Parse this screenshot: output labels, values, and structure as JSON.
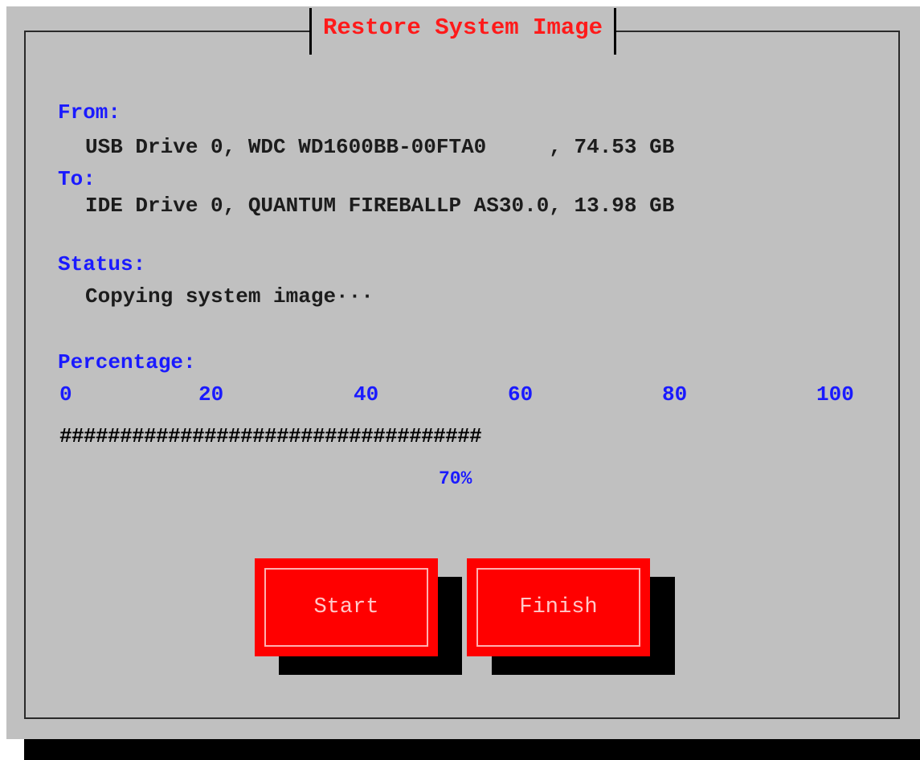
{
  "dialog": {
    "title": "Restore System Image",
    "from_label": "From:",
    "from_value": "USB Drive 0, WDC WD1600BB-00FTA0     , 74.53 GB",
    "to_label": "To:",
    "to_value": "IDE Drive 0, QUANTUM FIREBALLP AS30.0, 13.98 GB",
    "status_label": "Status:",
    "status_value": "Copying system image···",
    "percentage_label": "Percentage:",
    "scale_ticks": [
      "0",
      "20",
      "40",
      "60",
      "80",
      "100"
    ],
    "progress_bar": "###################################",
    "progress_fraction": 0.7,
    "percent_text": "70%"
  },
  "buttons": {
    "start_label": "Start",
    "finish_label": "Finish"
  },
  "colors": {
    "background": "#c0c0c0",
    "title": "#ff1a1a",
    "label": "#1a1aff",
    "button": "#ff0000",
    "shadow": "#000000"
  }
}
